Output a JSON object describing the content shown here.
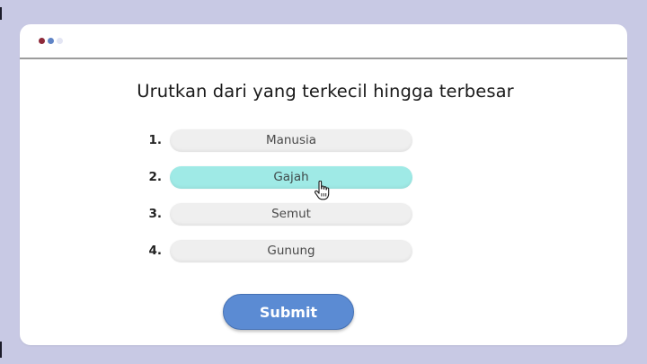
{
  "window": {
    "controls": [
      {
        "name": "close-dot",
        "color": "#8e2a3a"
      },
      {
        "name": "minimize-dot",
        "color": "#5f84c6"
      },
      {
        "name": "maximize-dot",
        "color": "#e3e5f3"
      }
    ]
  },
  "question": {
    "text": "Urutkan dari yang terkecil hingga terbesar"
  },
  "items": [
    {
      "number": "1.",
      "label": "Manusia",
      "selected": false
    },
    {
      "number": "2.",
      "label": "Gajah",
      "selected": true
    },
    {
      "number": "3.",
      "label": "Semut",
      "selected": false
    },
    {
      "number": "4.",
      "label": "Gunung",
      "selected": false
    }
  ],
  "submit": {
    "label": "Submit"
  },
  "colors": {
    "background": "#c8c9e4",
    "selected_item": "#9feae6",
    "item": "#efefef",
    "submit_button": "#5b8bd3"
  },
  "cursor": {
    "icon": "hand-pointer-icon"
  }
}
